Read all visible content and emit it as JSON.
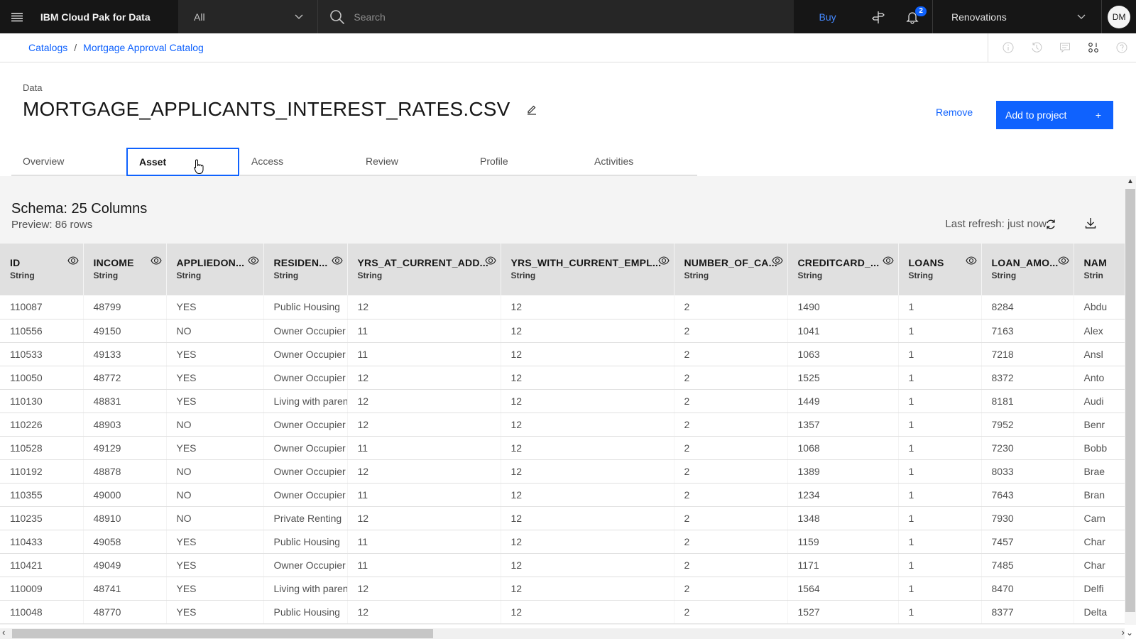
{
  "topbar": {
    "brand": "IBM Cloud Pak for Data",
    "scope_select": "All",
    "search_placeholder": "Search",
    "buy_label": "Buy",
    "notification_count": "2",
    "project_select": "Renovations",
    "avatar_initials": "DM"
  },
  "breadcrumb": {
    "items": [
      "Catalogs",
      "Mortgage Approval Catalog"
    ],
    "separator": "/"
  },
  "header": {
    "asset_type": "Data",
    "title": "MORTGAGE_APPLICANTS_INTEREST_RATES.CSV",
    "remove_label": "Remove",
    "add_label": "Add to project",
    "add_icon": "+"
  },
  "tabs": [
    {
      "label": "Overview",
      "active": false
    },
    {
      "label": "Asset",
      "active": true
    },
    {
      "label": "Access",
      "active": false
    },
    {
      "label": "Review",
      "active": false
    },
    {
      "label": "Profile",
      "active": false
    },
    {
      "label": "Activities",
      "active": false
    }
  ],
  "schema": {
    "title": "Schema:  25 Columns",
    "preview": "Preview: 86 rows",
    "last_refresh": "Last refresh: just now"
  },
  "table": {
    "columns": [
      {
        "name": "ID",
        "type": "String"
      },
      {
        "name": "INCOME",
        "type": "String"
      },
      {
        "name": "APPLIEDON...",
        "type": "String"
      },
      {
        "name": "RESIDEN...",
        "type": "String"
      },
      {
        "name": "YRS_AT_CURRENT_ADD...",
        "type": "String"
      },
      {
        "name": "YRS_WITH_CURRENT_EMPL...",
        "type": "String"
      },
      {
        "name": "NUMBER_OF_CA...",
        "type": "String"
      },
      {
        "name": "CREDITCARD_...",
        "type": "String"
      },
      {
        "name": "LOANS",
        "type": "String"
      },
      {
        "name": "LOAN_AMO...",
        "type": "String"
      },
      {
        "name": "NAM",
        "type": "Strin"
      }
    ],
    "rows": [
      [
        "110087",
        "48799",
        "YES",
        "Public Housing",
        "12",
        "12",
        "2",
        "1490",
        "1",
        "8284",
        "Abdu"
      ],
      [
        "110556",
        "49150",
        "NO",
        "Owner Occupier",
        "11",
        "12",
        "2",
        "1041",
        "1",
        "7163",
        "Alex"
      ],
      [
        "110533",
        "49133",
        "YES",
        "Owner Occupier",
        "11",
        "12",
        "2",
        "1063",
        "1",
        "7218",
        "Ansl"
      ],
      [
        "110050",
        "48772",
        "YES",
        "Owner Occupier",
        "12",
        "12",
        "2",
        "1525",
        "1",
        "8372",
        "Anto"
      ],
      [
        "110130",
        "48831",
        "YES",
        "Living with paren",
        "12",
        "12",
        "2",
        "1449",
        "1",
        "8181",
        "Audi"
      ],
      [
        "110226",
        "48903",
        "NO",
        "Owner Occupier",
        "12",
        "12",
        "2",
        "1357",
        "1",
        "7952",
        "Benr"
      ],
      [
        "110528",
        "49129",
        "YES",
        "Owner Occupier",
        "11",
        "12",
        "2",
        "1068",
        "1",
        "7230",
        "Bobb"
      ],
      [
        "110192",
        "48878",
        "NO",
        "Owner Occupier",
        "12",
        "12",
        "2",
        "1389",
        "1",
        "8033",
        "Brae"
      ],
      [
        "110355",
        "49000",
        "NO",
        "Owner Occupier",
        "11",
        "12",
        "2",
        "1234",
        "1",
        "7643",
        "Bran"
      ],
      [
        "110235",
        "48910",
        "NO",
        "Private Renting",
        "12",
        "12",
        "2",
        "1348",
        "1",
        "7930",
        "Carn"
      ],
      [
        "110433",
        "49058",
        "YES",
        "Public Housing",
        "11",
        "12",
        "2",
        "1159",
        "1",
        "7457",
        "Char"
      ],
      [
        "110421",
        "49049",
        "YES",
        "Owner Occupier",
        "11",
        "12",
        "2",
        "1171",
        "1",
        "7485",
        "Char"
      ],
      [
        "110009",
        "48741",
        "YES",
        "Living with paren",
        "12",
        "12",
        "2",
        "1564",
        "1",
        "8470",
        "Delfi"
      ],
      [
        "110048",
        "48770",
        "YES",
        "Public Housing",
        "12",
        "12",
        "2",
        "1527",
        "1",
        "8377",
        "Delta"
      ]
    ]
  },
  "colors": {
    "accent": "#0f62fe",
    "topbar_bg": "#161616",
    "header_row_bg": "#e0e0e0",
    "content_bg": "#f4f4f4"
  }
}
